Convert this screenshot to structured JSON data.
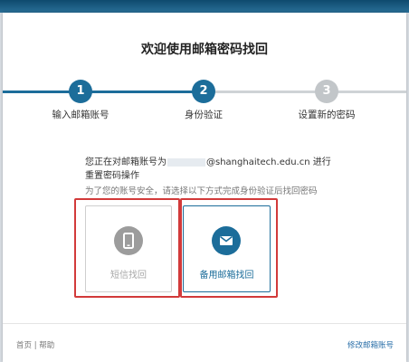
{
  "title": "欢迎使用邮箱密码找回",
  "steps": [
    {
      "number": "1",
      "label": "输入邮箱账号",
      "status": "done"
    },
    {
      "number": "2",
      "label": "身份验证",
      "status": "current"
    },
    {
      "number": "3",
      "label": "设置新的密码",
      "status": "pending"
    }
  ],
  "info": {
    "prefix": "您正在对邮箱账号为",
    "domain": "@shanghaitech.edu.cn",
    "suffix": " 进行重置密码操作",
    "hint": "为了您的账号安全，请选择以下方式完成身份验证后找回密码"
  },
  "options": [
    {
      "label": "短信找回",
      "icon": "phone-icon",
      "state": "disabled"
    },
    {
      "label": "备用邮箱找回",
      "icon": "mail-icon",
      "state": "enabled"
    }
  ],
  "footer": {
    "home": "首页",
    "separator": "|",
    "help": "帮助",
    "modify": "修改邮箱账号"
  },
  "colors": {
    "accent": "#1c6d9a",
    "inactive": "#c2c6c9",
    "highlight": "#d23a3a"
  }
}
